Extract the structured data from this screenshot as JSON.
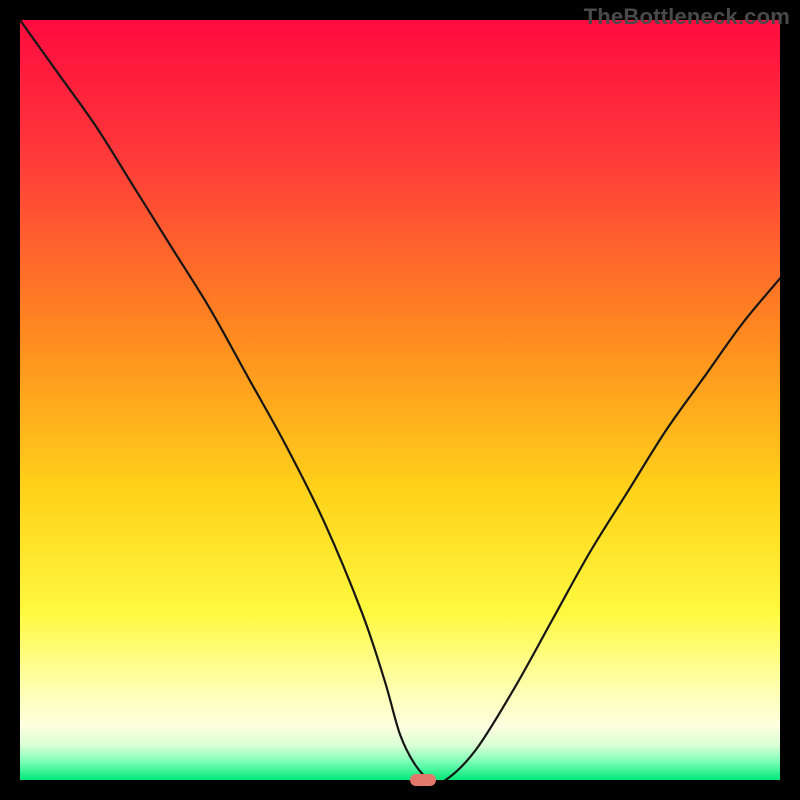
{
  "watermark": "TheBottleneck.com",
  "chart_data": {
    "type": "line",
    "title": "",
    "xlabel": "",
    "ylabel": "",
    "xlim": [
      0,
      100
    ],
    "ylim": [
      0,
      100
    ],
    "grid": false,
    "legend": false,
    "background_gradient": {
      "type": "vertical",
      "stops": [
        {
          "pos": 0.0,
          "color": "#ff0b3f"
        },
        {
          "pos": 0.18,
          "color": "#ff3a3a"
        },
        {
          "pos": 0.42,
          "color": "#ff8c1f"
        },
        {
          "pos": 0.62,
          "color": "#ffd21a"
        },
        {
          "pos": 0.78,
          "color": "#fff940"
        },
        {
          "pos": 0.88,
          "color": "#ffffb0"
        },
        {
          "pos": 0.93,
          "color": "#fdffe0"
        },
        {
          "pos": 0.955,
          "color": "#d9ffd5"
        },
        {
          "pos": 0.975,
          "color": "#7fffb8"
        },
        {
          "pos": 1.0,
          "color": "#00e878"
        }
      ]
    },
    "series": [
      {
        "name": "bottleneck-curve",
        "color": "#161616",
        "stroke_width": 2.2,
        "x": [
          0,
          5,
          10,
          15,
          20,
          25,
          30,
          35,
          40,
          45,
          48,
          50,
          52,
          54,
          56,
          60,
          65,
          70,
          75,
          80,
          85,
          90,
          95,
          100
        ],
        "y": [
          100,
          93,
          86,
          78,
          70,
          62,
          53,
          44,
          34,
          22,
          13,
          6,
          2,
          0,
          0,
          4,
          12,
          21,
          30,
          38,
          46,
          53,
          60,
          66
        ]
      }
    ],
    "marker": {
      "x": 53,
      "y": 0,
      "shape": "rounded-rect",
      "color": "#e2786b"
    }
  }
}
